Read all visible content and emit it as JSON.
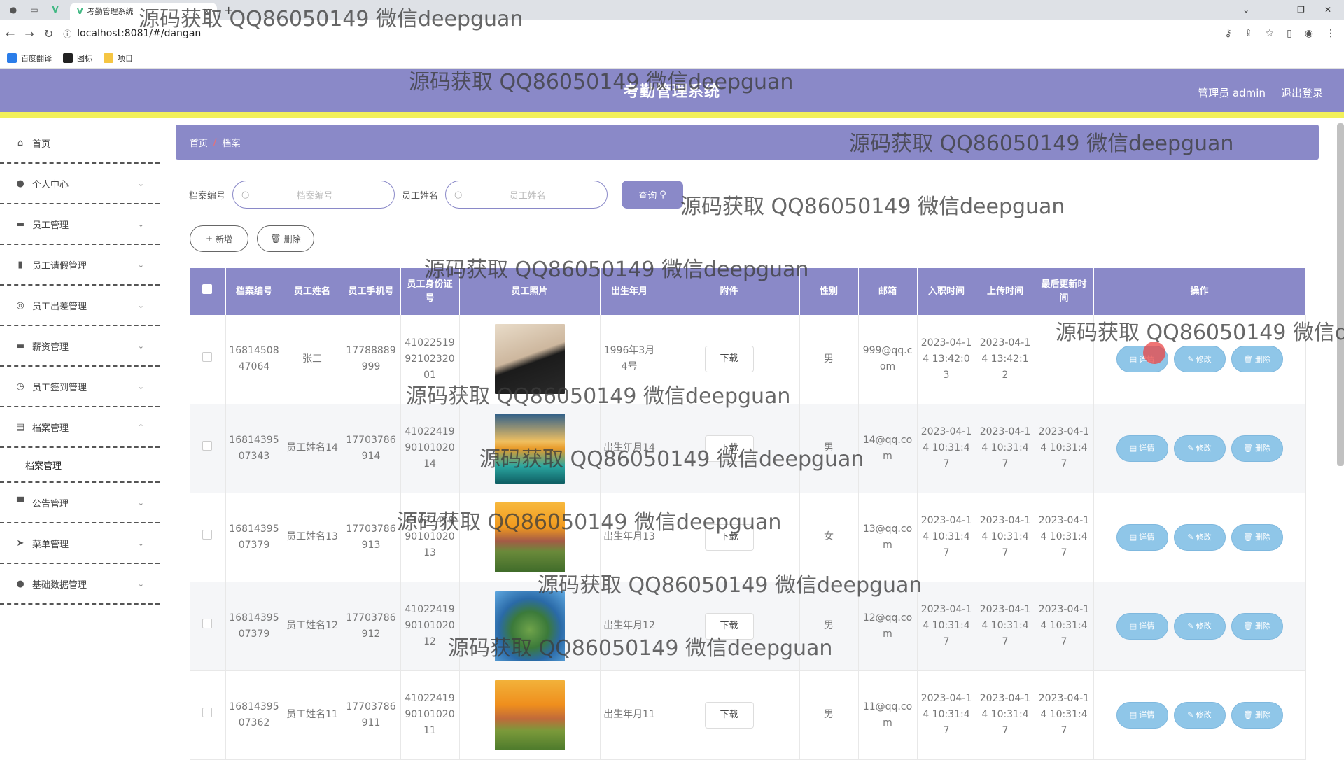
{
  "browser": {
    "tab_title": "考勤管理系统",
    "url": "localhost:8081/#/dangan",
    "bookmarks": [
      "百度翻译",
      "图标",
      "项目"
    ]
  },
  "header": {
    "title": "考勤管理系统",
    "user": "管理员 admin",
    "logout": "退出登录"
  },
  "sidebar": {
    "items": [
      {
        "label": "首页",
        "icon": "home-icon"
      },
      {
        "label": "个人中心",
        "icon": "user-icon"
      },
      {
        "label": "员工管理",
        "icon": "folder-icon"
      },
      {
        "label": "员工请假管理",
        "icon": "chart-icon"
      },
      {
        "label": "员工出差管理",
        "icon": "clock-icon"
      },
      {
        "label": "薪资管理",
        "icon": "folder-icon"
      },
      {
        "label": "员工签到管理",
        "icon": "clock-icon"
      },
      {
        "label": "档案管理",
        "icon": "doc-icon"
      },
      {
        "label": "公告管理",
        "icon": "monitor-icon"
      },
      {
        "label": "菜单管理",
        "icon": "send-icon"
      },
      {
        "label": "基础数据管理",
        "icon": "user-icon"
      }
    ],
    "submenu": "档案管理"
  },
  "breadcrumb": {
    "home": "首页",
    "sep": "/",
    "current": "档案"
  },
  "search": {
    "label1": "档案编号",
    "placeholder1": "档案编号",
    "label2": "员工姓名",
    "placeholder2": "员工姓名",
    "query": "查询"
  },
  "actions": {
    "add": "新增",
    "delete": "删除"
  },
  "table": {
    "headers": [
      "档案编号",
      "员工姓名",
      "员工手机号",
      "员工身份证号",
      "员工照片",
      "出生年月",
      "附件",
      "性别",
      "邮箱",
      "入职时间",
      "上传时间",
      "最后更新时间",
      "操作"
    ],
    "rows": [
      {
        "id": "1681450847064",
        "name": "张三",
        "phone": "17788889999",
        "idcard": "410225199210232001",
        "birth": "1996年3月4号",
        "file": "下载",
        "gender": "男",
        "email": "999@qq.com",
        "join": "2023-04-14 13:42:03",
        "upload": "2023-04-14 13:42:12",
        "update": ""
      },
      {
        "id": "1681439507343",
        "name": "员工姓名14",
        "phone": "17703786914",
        "idcard": "410224199010102014",
        "birth": "出生年月14",
        "file": "下载",
        "gender": "男",
        "email": "14@qq.com",
        "join": "2023-04-14 10:31:47",
        "upload": "2023-04-14 10:31:47",
        "update": "2023-04-14 10:31:47"
      },
      {
        "id": "1681439507379",
        "name": "员工姓名13",
        "phone": "17703786913",
        "idcard": "410224199010102013",
        "birth": "出生年月13",
        "file": "下载",
        "gender": "女",
        "email": "13@qq.com",
        "join": "2023-04-14 10:31:47",
        "upload": "2023-04-14 10:31:47",
        "update": "2023-04-14 10:31:47"
      },
      {
        "id": "1681439507379",
        "name": "员工姓名12",
        "phone": "17703786912",
        "idcard": "410224199010102012",
        "birth": "出生年月12",
        "file": "下载",
        "gender": "男",
        "email": "12@qq.com",
        "join": "2023-04-14 10:31:47",
        "upload": "2023-04-14 10:31:47",
        "update": "2023-04-14 10:31:47"
      },
      {
        "id": "1681439507362",
        "name": "员工姓名11",
        "phone": "17703786911",
        "idcard": "410224199010102011",
        "birth": "出生年月11",
        "file": "下载",
        "gender": "男",
        "email": "11@qq.com",
        "join": "2023-04-14 10:31:47",
        "upload": "2023-04-14 10:31:47",
        "update": "2023-04-14 10:31:47"
      }
    ],
    "op_labels": {
      "detail": "详情",
      "edit": "修改",
      "delete": "删除"
    }
  },
  "watermark": "源码获取 QQ86050149 微信deepguan",
  "colors": {
    "theme": "#8a89c8",
    "accent": "#f2f05a",
    "op_button": "#8fc6e8"
  }
}
